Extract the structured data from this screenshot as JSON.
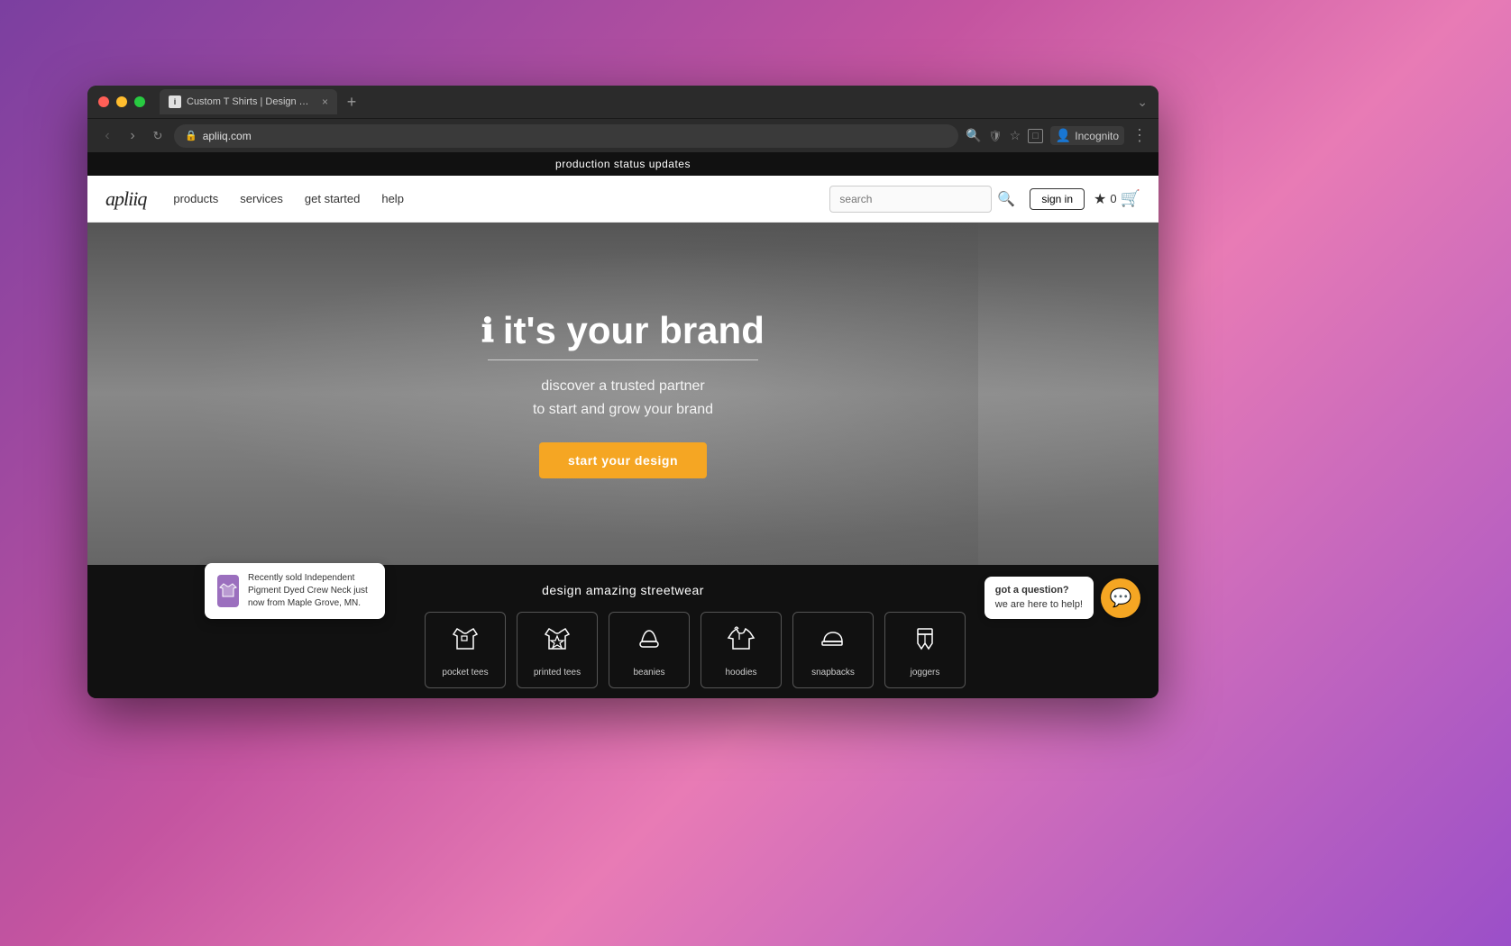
{
  "browser": {
    "tab_title": "Custom T Shirts | Design Your",
    "tab_favicon_text": "i",
    "url": "apliiq.com",
    "incognito_label": "Incognito"
  },
  "site": {
    "top_banner": "production status updates",
    "logo": "apliiq",
    "nav_links": [
      {
        "label": "products"
      },
      {
        "label": "services"
      },
      {
        "label": "get started"
      },
      {
        "label": "help"
      }
    ],
    "search_placeholder": "search",
    "sign_in_label": "sign in",
    "cart_count": "0",
    "hero": {
      "title": "it's your brand",
      "title_icon": "ℹ",
      "subtitle_line1": "discover a trusted partner",
      "subtitle_line2": "to start and grow your brand",
      "cta_label": "start your design"
    },
    "bottom": {
      "section_title": "design amazing streetwear",
      "categories": [
        {
          "label": "pocket tees",
          "icon": "👕"
        },
        {
          "label": "printed tees",
          "icon": "⭐"
        },
        {
          "label": "beanies",
          "icon": "🧢"
        },
        {
          "label": "hoodies",
          "icon": "🧥"
        },
        {
          "label": "snapbacks",
          "icon": "🧢"
        },
        {
          "label": "joggers",
          "icon": "👖"
        }
      ]
    },
    "recently_sold": {
      "text": "Recently sold Independent Pigment Dyed Crew Neck just now from Maple Grove, MN.",
      "item_color": "#9B6FBE"
    },
    "chat": {
      "title": "got a question?",
      "subtitle": "we are here to help!"
    }
  }
}
